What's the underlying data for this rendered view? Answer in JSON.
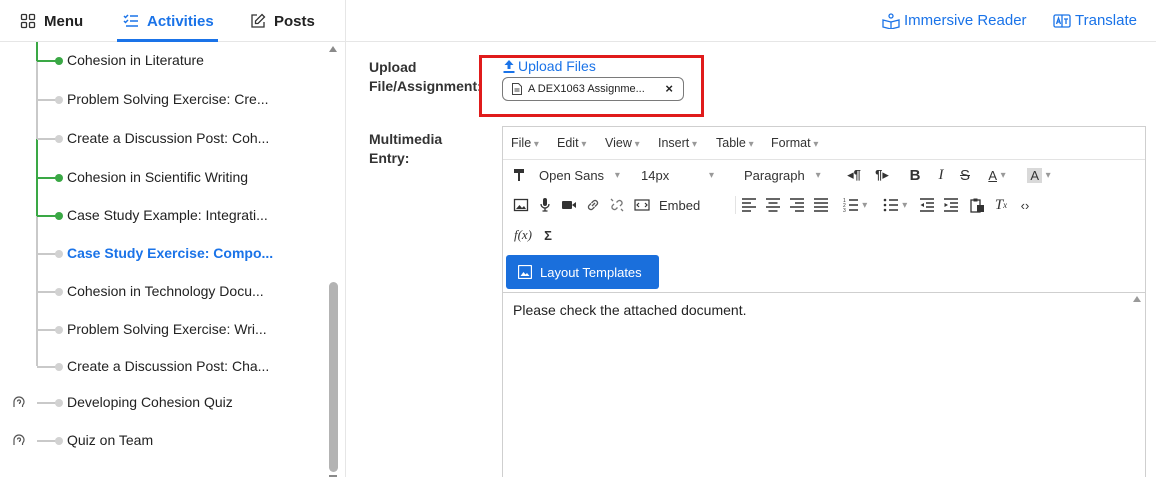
{
  "tabs": [
    {
      "label": "Menu",
      "icon": "grid-icon"
    },
    {
      "label": "Activities",
      "icon": "checklist-icon"
    },
    {
      "label": "Posts",
      "icon": "edit-icon"
    }
  ],
  "tree": {
    "items": [
      {
        "label": "Cohesion in Literature",
        "status": "done"
      },
      {
        "label": "Problem Solving Exercise: Cre...",
        "status": "pending"
      },
      {
        "label": "Create a Discussion Post: Coh...",
        "status": "pending"
      },
      {
        "label": "Cohesion in Scientific Writing",
        "status": "done"
      },
      {
        "label": "Case Study Example: Integrati...",
        "status": "done"
      },
      {
        "label": "Case Study Exercise: Compo...",
        "status": "current"
      },
      {
        "label": "Cohesion in Technology Docu...",
        "status": "pending"
      },
      {
        "label": "Problem Solving Exercise: Wri...",
        "status": "pending"
      },
      {
        "label": "Create a Discussion Post: Cha...",
        "status": "pending"
      },
      {
        "label": "Developing Cohesion Quiz",
        "status": "pending",
        "quiz": true
      },
      {
        "label": "Quiz on Team",
        "status": "pending",
        "quiz": true
      }
    ]
  },
  "topbar": {
    "immersive_reader": "Immersive Reader",
    "translate": "Translate"
  },
  "form": {
    "upload_label": "Upload File/Assignment:",
    "upload_link": "Upload Files",
    "attached_file": "A DEX1063 Assignme...",
    "multimedia_label": "Multimedia Entry:"
  },
  "editor": {
    "menus": [
      "File",
      "Edit",
      "View",
      "Insert",
      "Table",
      "Format"
    ],
    "font_family": "Open Sans",
    "font_size": "14px",
    "block_format": "Paragraph",
    "embed_label": "Embed",
    "layout_templates": "Layout Templates",
    "content": "Please check the attached document."
  },
  "colors": {
    "accent": "#1a73e8",
    "done_green": "#3aa845",
    "highlight_red": "#e01b1b",
    "primary_button": "#1a6fdc"
  }
}
